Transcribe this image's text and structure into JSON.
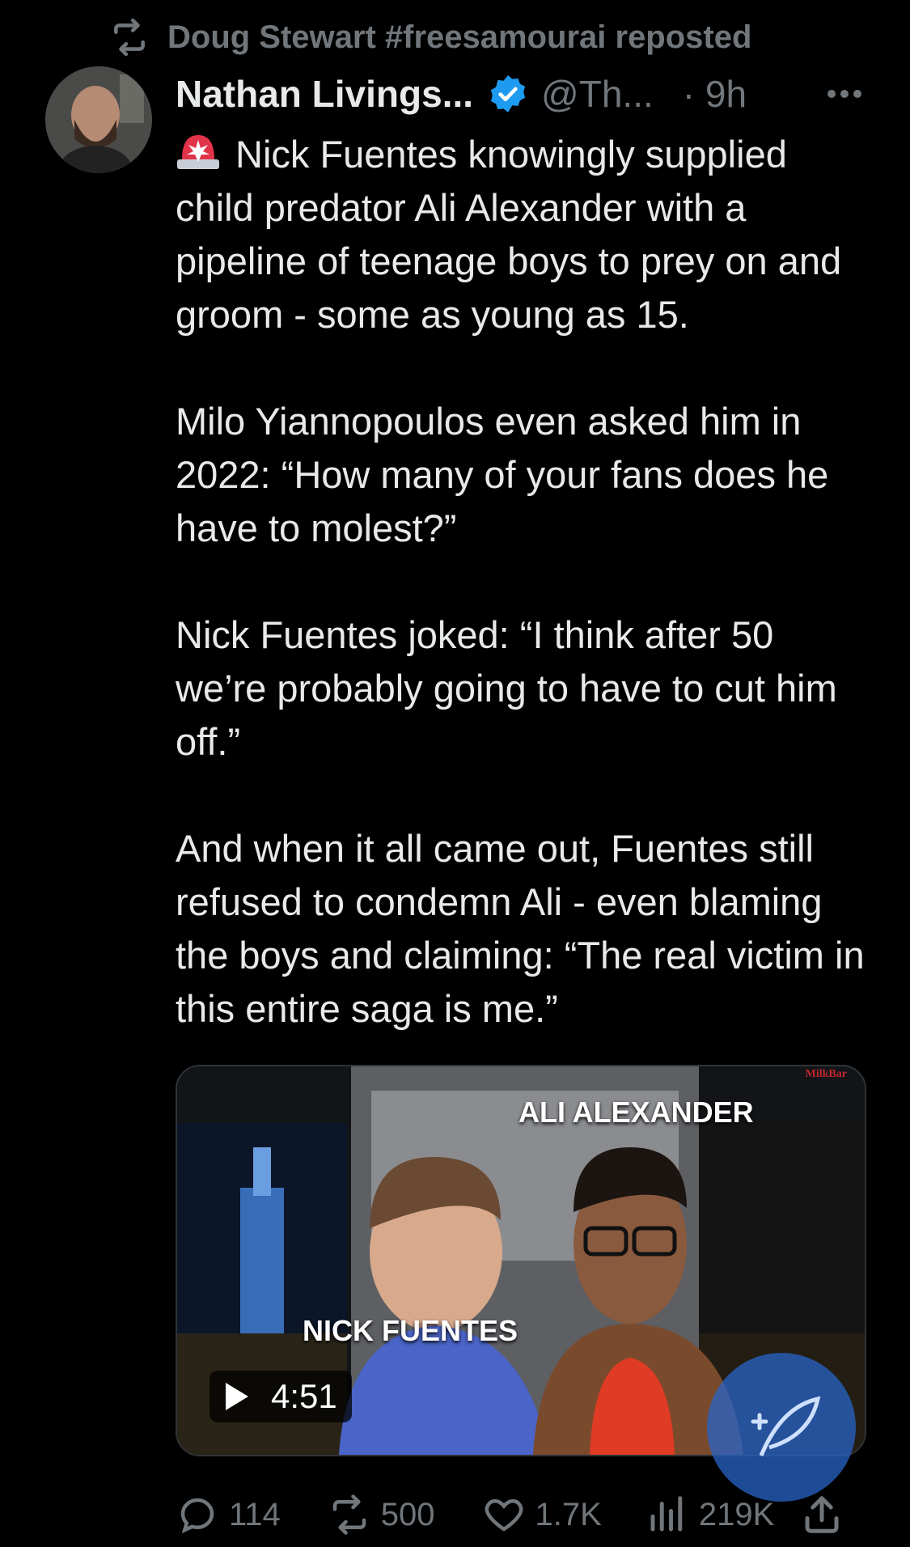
{
  "repost": {
    "text": "Doug Stewart #freesamourai reposted",
    "icon": "repost-icon"
  },
  "tweet": {
    "author_name": "Nathan Livings...",
    "handle": "@Th...",
    "time": "· 9h",
    "verified": true,
    "paragraphs": [
      "Nick Fuentes knowingly supplied child predator Ali Alexander with a pipeline of teenage boys to prey on and groom - some as young as 15.",
      "Milo Yiannopoulos even asked him in 2022: “How many of your fans does he have to molest?”",
      "Nick Fuentes joked: “I think after 50 we’re probably going to have to cut him off.”",
      "And when it all came out, Fuentes still refused to condemn Ali - even blaming the boys and claiming: “The real victim in this entire saga is me.”"
    ]
  },
  "media": {
    "label_top": "ALI ALEXANDER",
    "label_bottom": "NICK FUENTES",
    "watermark": "MilkBar",
    "duration": "4:51"
  },
  "actions": {
    "replies": "114",
    "reposts": "500",
    "likes": "1.7K",
    "views": "219K"
  },
  "colors": {
    "background": "#000000",
    "text": "#e7e9ea",
    "muted": "#71767b",
    "verified": "#1d9bf0"
  }
}
